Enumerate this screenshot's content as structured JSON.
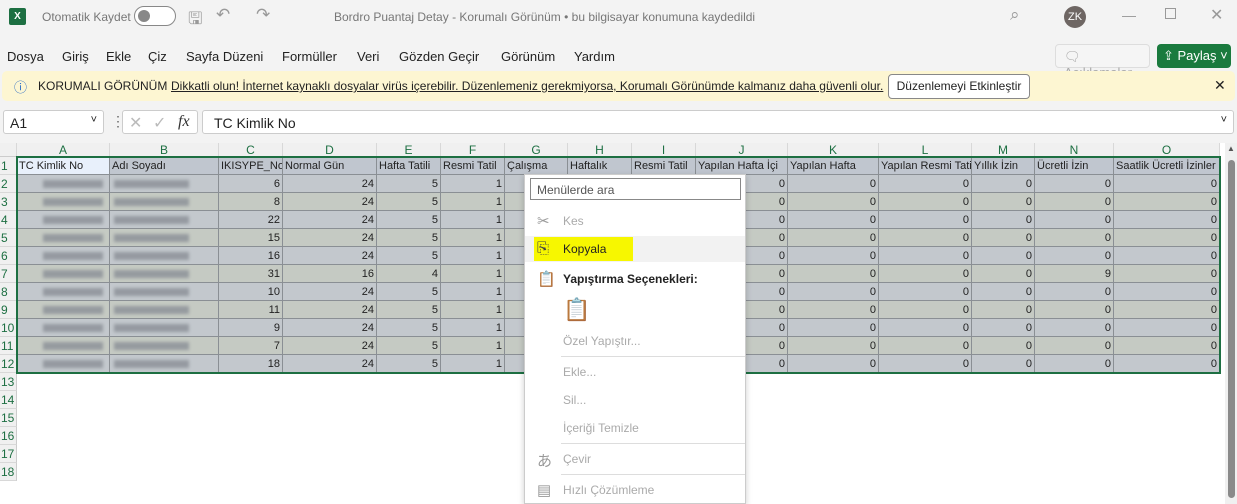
{
  "titlebar": {
    "autosave_label": "Otomatik Kaydet",
    "logo": "X",
    "title": "Bordro Puantaj Detay  -  Korumalı Görünüm  •  bu bilgisayar konumuna kaydedildi",
    "avatar": "ZK"
  },
  "menu": [
    "Dosya",
    "Giriş",
    "Ekle",
    "Çiz",
    "Sayfa Düzeni",
    "Formüller",
    "Veri",
    "Gözden Geçir",
    "Görünüm",
    "Yardım"
  ],
  "comments_label": "Açıklamalar",
  "share_label": "Paylaş",
  "protected_view": {
    "title": "KORUMALI GÖRÜNÜM",
    "message": "Dikkatli olun! İnternet kaynaklı dosyalar virüs içerebilir. Düzenlemeniz gerekmiyorsa, Korumalı Görünümde kalmanız daha güvenli olur.",
    "button": "Düzenlemeyi Etkinleştir"
  },
  "name_box": "A1",
  "formula": "TC Kimlik No",
  "columns": [
    "A",
    "B",
    "C",
    "D",
    "E",
    "F",
    "G",
    "H",
    "I",
    "J",
    "K",
    "L",
    "M",
    "N",
    "O"
  ],
  "headers": [
    "TC Kimlik No",
    "Adı Soyadı",
    "IKISYPE_No",
    "Normal Gün",
    "Hafta Tatili",
    "Resmi Tatil",
    "Çalışma",
    "Haftalık",
    "Resmi Tatil",
    "Yapılan Hafta İçi",
    "Yapılan Hafta",
    "Yapılan Resmi Tatil",
    "Yıllık İzin",
    "Ücretli İzin",
    "Saatlik Ücretli İzinler"
  ],
  "rows": [
    [
      6,
      24,
      5,
      1,
      0,
      0,
      0,
      0,
      0,
      0
    ],
    [
      8,
      24,
      5,
      1,
      0,
      0,
      0,
      0,
      0,
      0
    ],
    [
      22,
      24,
      5,
      1,
      0,
      0,
      0,
      0,
      0,
      0
    ],
    [
      15,
      24,
      5,
      1,
      0,
      0,
      0,
      0,
      0,
      0
    ],
    [
      16,
      24,
      5,
      1,
      0,
      0,
      0,
      0,
      0,
      0
    ],
    [
      31,
      16,
      4,
      1,
      0,
      0,
      0,
      0,
      9,
      0
    ],
    [
      10,
      24,
      5,
      1,
      0,
      0,
      0,
      0,
      0,
      0
    ],
    [
      11,
      24,
      5,
      1,
      0,
      0,
      0,
      0,
      0,
      0
    ],
    [
      9,
      24,
      5,
      1,
      0,
      0,
      0,
      0,
      0,
      0
    ],
    [
      7,
      24,
      5,
      1,
      0,
      0,
      0,
      0,
      0,
      0
    ],
    [
      18,
      24,
      5,
      1,
      0,
      0,
      0,
      0,
      0,
      0
    ]
  ],
  "row_count": 18,
  "context_menu": {
    "search_placeholder": "Menülerde ara",
    "items": [
      {
        "label": "Kes",
        "icon": "scissors-icon",
        "enabled": false
      },
      {
        "label": "Kopyala",
        "icon": "copy-icon",
        "enabled": true,
        "highlighted": true
      },
      {
        "label": "Yapıştırma Seçenekleri:",
        "icon": "paste-icon",
        "enabled": true,
        "bold": true
      },
      {
        "label": "Özel Yapıştır...",
        "enabled": false
      },
      {
        "label": "Ekle...",
        "enabled": false
      },
      {
        "label": "Sil...",
        "enabled": false
      },
      {
        "label": "İçeriği Temizle",
        "enabled": false
      },
      {
        "label": "Çevir",
        "icon": "translate-icon",
        "enabled": false
      },
      {
        "label": "Hızlı Çözümleme",
        "icon": "quick-analysis-icon",
        "enabled": false
      }
    ]
  },
  "colors": {
    "accent": "#1d6f42",
    "row_odd": "#c3c8cd",
    "row_even": "#c5cac3",
    "highlight": "#f7f700",
    "banner": "#fdf6d2"
  }
}
